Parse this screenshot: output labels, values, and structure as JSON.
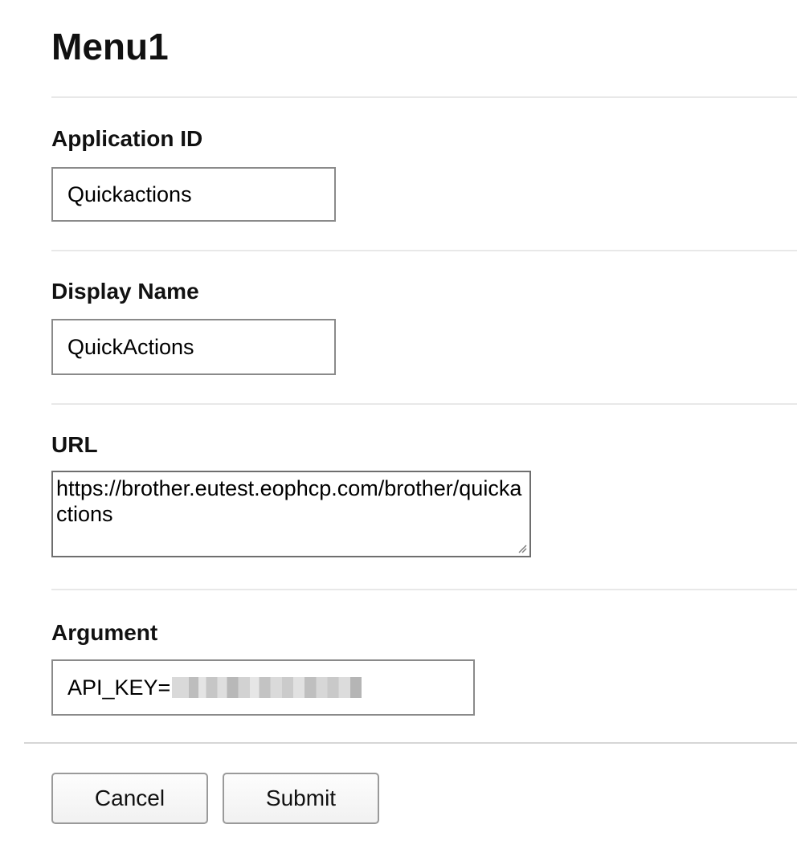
{
  "page": {
    "title": "Menu1"
  },
  "fields": {
    "application_id": {
      "label": "Application ID",
      "value": "Quickactions"
    },
    "display_name": {
      "label": "Display Name",
      "value": "QuickActions"
    },
    "url": {
      "label": "URL",
      "value": "https://brother.eutest.eophcp.com/brother/quickactions"
    },
    "argument": {
      "label": "Argument",
      "value": "API_KEY=",
      "masked": true
    }
  },
  "actions": {
    "cancel_label": "Cancel",
    "submit_label": "Submit"
  },
  "icons": {
    "resize_grip": "resize-grip-icon"
  },
  "colors": {
    "input_border": "#8a8a8a",
    "divider": "#e8e8e8",
    "button_border": "#9a9a9a"
  }
}
